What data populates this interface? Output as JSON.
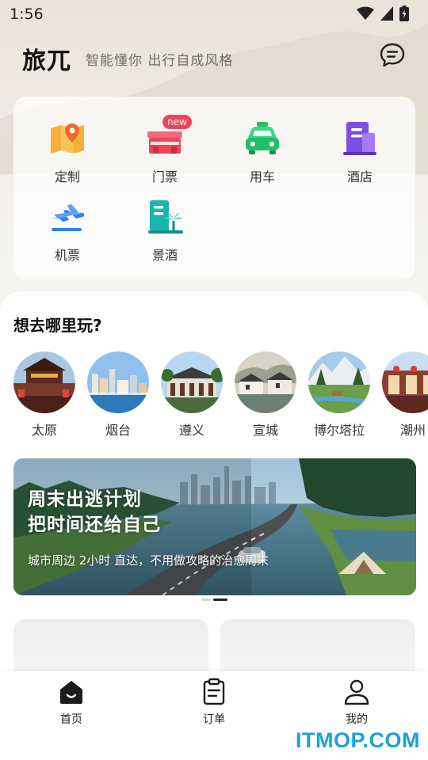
{
  "status_bar": {
    "time": "1:56"
  },
  "header": {
    "logo": "旅兀",
    "tagline": "智能懂你 出行自成风格"
  },
  "services": [
    {
      "label": "定制",
      "icon": "map-pin-icon",
      "color": "#f5a623"
    },
    {
      "label": "门票",
      "icon": "ticket-gate-icon",
      "color": "#f0445a",
      "badge": "new"
    },
    {
      "label": "用车",
      "icon": "taxi-icon",
      "color": "#1fbf6b"
    },
    {
      "label": "酒店",
      "icon": "hotel-icon",
      "color": "#7b4fe0"
    },
    {
      "label": "机票",
      "icon": "airplane-icon",
      "color": "#2f7ff0"
    },
    {
      "label": "景酒",
      "icon": "resort-hotel-icon",
      "color": "#18b6b0"
    }
  ],
  "destinations": {
    "title": "想去哪里玩?",
    "items": [
      {
        "name": "太原"
      },
      {
        "name": "烟台"
      },
      {
        "name": "遵义"
      },
      {
        "name": "宣城"
      },
      {
        "name": "博尔塔拉"
      },
      {
        "name": "潮州"
      }
    ]
  },
  "banner": {
    "title_line1": "周末出逃计划",
    "title_line2": "把时间还给自己",
    "subtitle": "城市周边 2小时 直达，不用做攻略的治愈周末",
    "page_index": 2,
    "page_count": 2
  },
  "bottom_nav": [
    {
      "label": "首页",
      "icon": "home-icon",
      "active": true
    },
    {
      "label": "订单",
      "icon": "orders-icon",
      "active": false
    },
    {
      "label": "我的",
      "icon": "profile-icon",
      "active": false
    }
  ],
  "watermark": "ITMOP.COM"
}
